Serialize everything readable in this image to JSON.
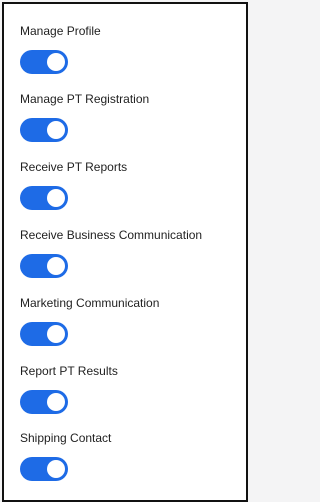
{
  "permissions": {
    "items": [
      {
        "label": "Manage Profile",
        "enabled": true
      },
      {
        "label": "Manage PT Registration",
        "enabled": true
      },
      {
        "label": "Receive PT Reports",
        "enabled": true
      },
      {
        "label": "Receive Business Communication",
        "enabled": true
      },
      {
        "label": "Marketing Communication",
        "enabled": true
      },
      {
        "label": "Report PT Results",
        "enabled": true
      },
      {
        "label": "Shipping Contact",
        "enabled": true
      }
    ],
    "toggle_on_color": "#1e6be6"
  }
}
